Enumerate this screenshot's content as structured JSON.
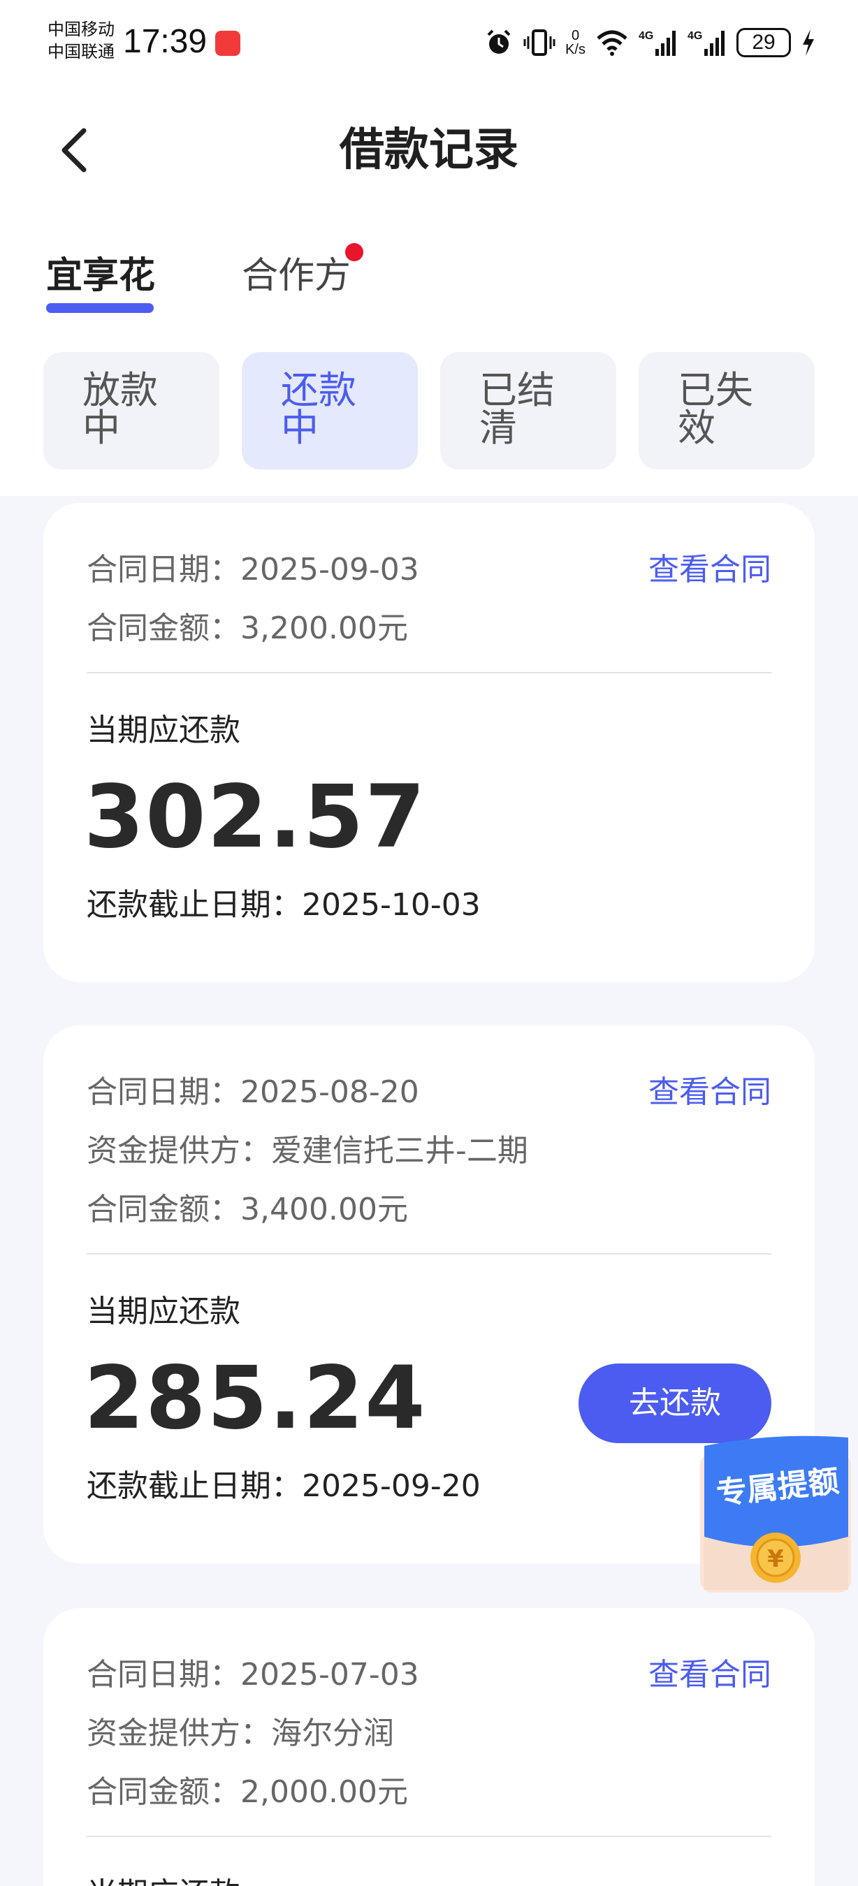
{
  "status_bar": {
    "carrier_1": "中国移动",
    "carrier_2": "中国联通",
    "time": "17:39",
    "net_speed_value": "0",
    "net_speed_unit": "K/s",
    "network_1": "4G",
    "network_2": "4G",
    "battery": "29"
  },
  "header": {
    "title": "借款记录",
    "tabs": [
      {
        "label": "宜享花",
        "active": true
      },
      {
        "label": "合作方",
        "active": false,
        "has_dot": true
      }
    ],
    "filters": [
      {
        "label": "放款中",
        "line1": "放款",
        "line2": "中",
        "active": false
      },
      {
        "label": "还款中",
        "line1": "还款",
        "line2": "中",
        "active": true
      },
      {
        "label": "已结清",
        "line1": "已结",
        "line2": "清",
        "active": false
      },
      {
        "label": "已失效",
        "line1": "已失",
        "line2": "效",
        "active": false
      }
    ]
  },
  "labels": {
    "contract_date": "合同日期：",
    "funder": "资金提供方：",
    "contract_amount": "合同金额：",
    "view_contract": "查看合同",
    "current_due": "当期应还款",
    "deadline": "还款截止日期：",
    "repay_button": "去还款"
  },
  "loans": [
    {
      "contract_date": "2025-09-03",
      "contract_amount": "3,200.00元",
      "current_due": "302.57",
      "deadline": "2025-10-03"
    },
    {
      "contract_date": "2025-08-20",
      "funder": "爱建信托三井-二期",
      "contract_amount": "3,400.00元",
      "current_due": "285.24",
      "deadline": "2025-09-20",
      "has_repay_button": true
    },
    {
      "contract_date": "2025-07-03",
      "funder": "海尔分润",
      "contract_amount": "2,000.00元",
      "current_due_label_partial": "当期应还款"
    }
  ],
  "promo": {
    "label": "专属提额"
  },
  "colors": {
    "accent": "#4c5cf0",
    "page_background": "#f4f6fc",
    "chip_active_bg": "#e4e9fd",
    "notification_dot": "#e8152b"
  }
}
